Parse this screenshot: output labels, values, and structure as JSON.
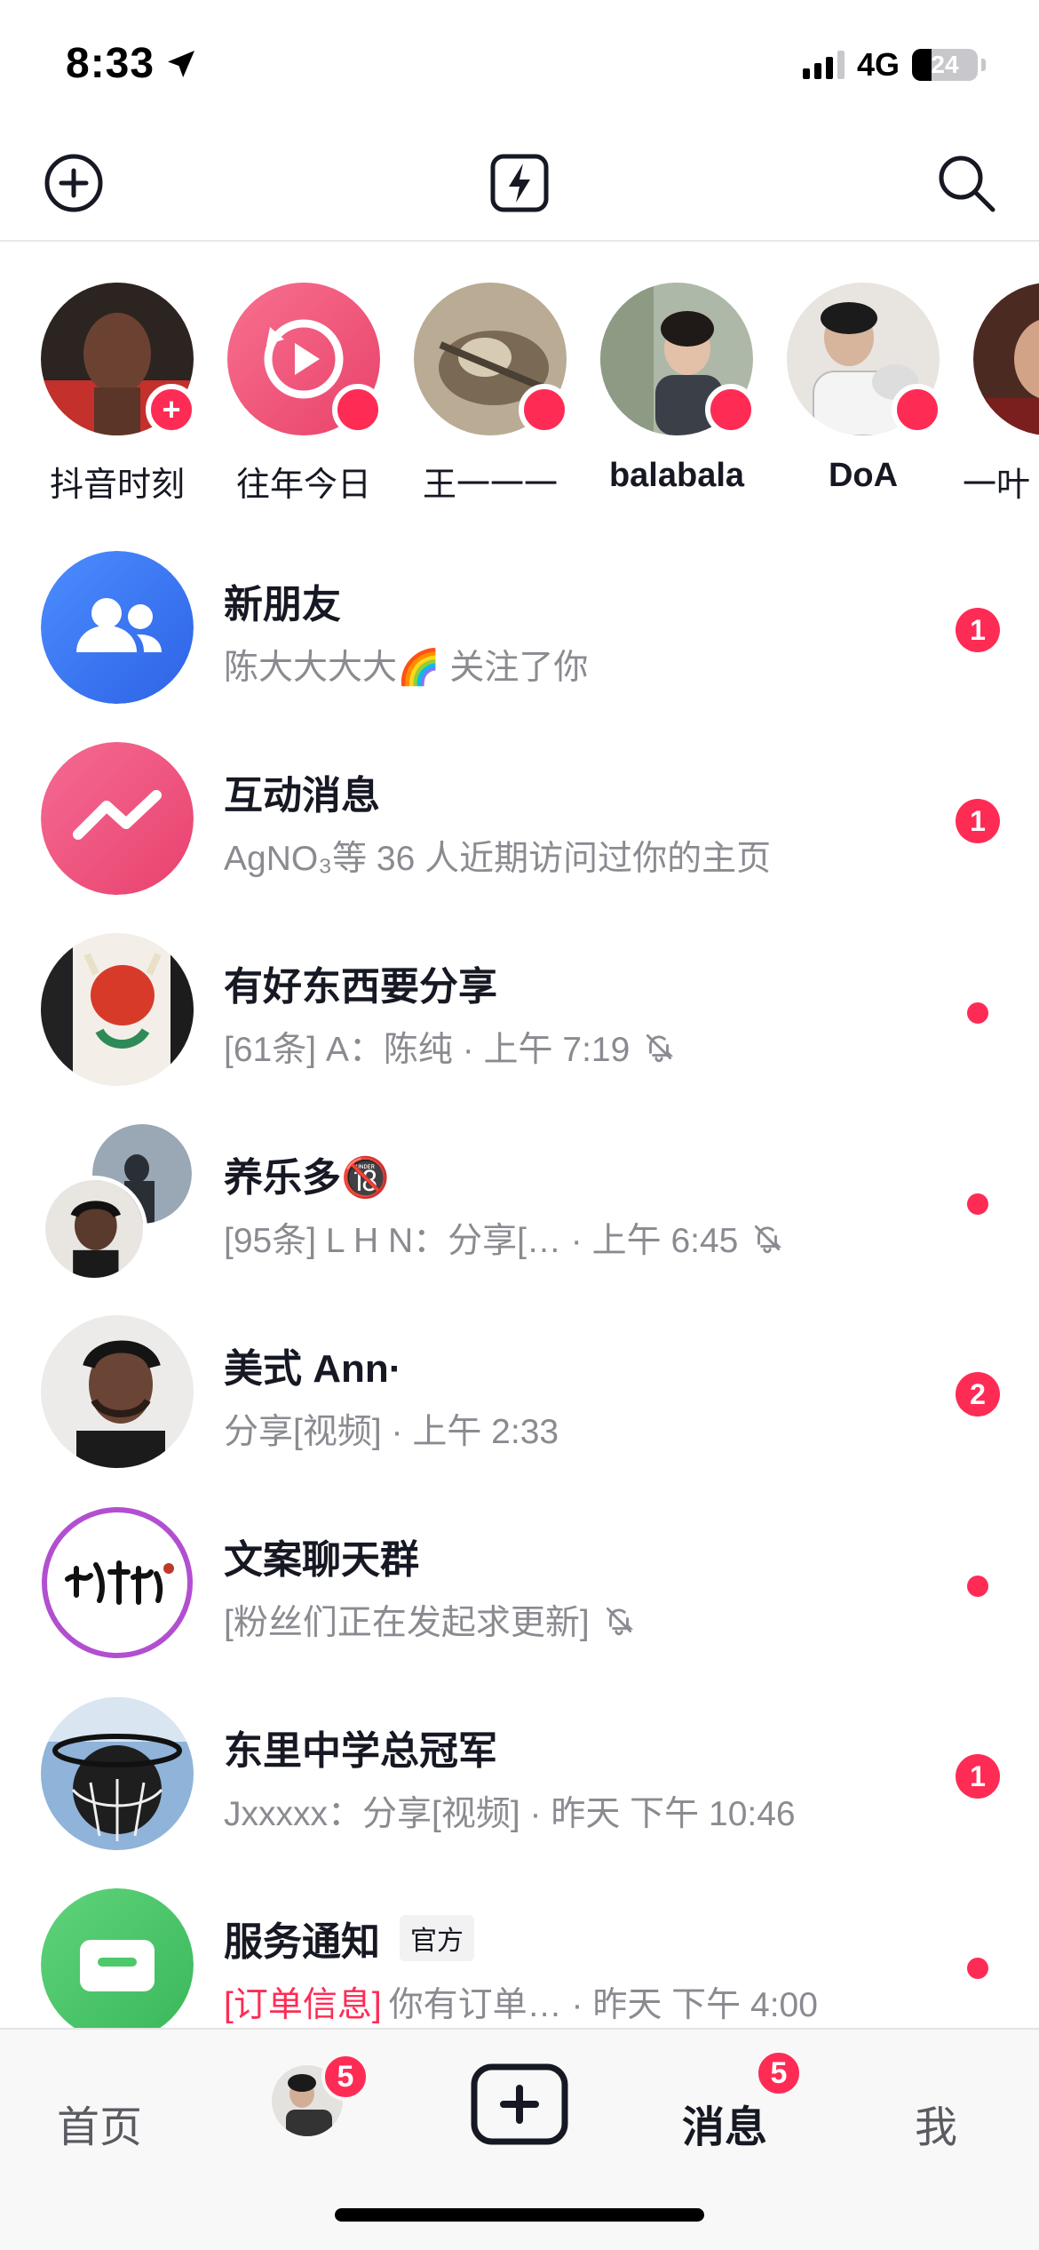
{
  "status_bar": {
    "time": "8:33",
    "network": "4G",
    "battery": "24"
  },
  "top_nav": {
    "left_icon": "add-circle-icon",
    "center_icon": "flash-icon",
    "right_icon": "search-icon"
  },
  "stories": [
    {
      "label": "抖音时刻",
      "badge": "+"
    },
    {
      "label": "往年今日",
      "badge": ""
    },
    {
      "label": "王一一一",
      "badge": ""
    },
    {
      "label": "balabala",
      "badge": ""
    },
    {
      "label": "DoA",
      "badge": ""
    },
    {
      "label": "一叶​",
      "badge": ""
    }
  ],
  "messages": [
    {
      "title": "新朋友",
      "subtitle": "陈大大大大🌈 关注了你",
      "badge": "1"
    },
    {
      "title": "互动消息",
      "subtitle": "AgNO₃等 36 人近期访问过你的主页",
      "badge": "1"
    },
    {
      "title": "有好东西要分享",
      "subtitle": "[61条] A：陈纯 · 上午 7:19"
    },
    {
      "title": "养乐多🔞",
      "subtitle": "[95条] L H N：分享[…    · 上午 6:45"
    },
    {
      "title": "美式 Ann·",
      "subtitle": "分享[视频] · 上午 2:33",
      "badge": "2"
    },
    {
      "title": "文案聊天群",
      "subtitle": "[粉丝们正在发起求更新]"
    },
    {
      "title": "东里中学总冠军",
      "subtitle": " Jxxxxx：分享[视频] · 昨天 下午 10:46",
      "badge": "1"
    },
    {
      "title": "服务通知",
      "tag": "官方",
      "subtitle_highlight": "[订单信息]",
      "subtitle": " 你有订单…  · 昨天 下午 4:00"
    }
  ],
  "tab_bar": {
    "home": "首页",
    "friend_badge": "5",
    "messages": "消息",
    "messages_badge": "5",
    "me": "我"
  },
  "colors": {
    "accent": "#fe2c55",
    "text_primary": "#161823",
    "text_secondary": "#8a8b91",
    "new_friends_blue": "#3b82f6",
    "interaction_pink": "#f2527f",
    "service_green": "#4cc96b"
  }
}
